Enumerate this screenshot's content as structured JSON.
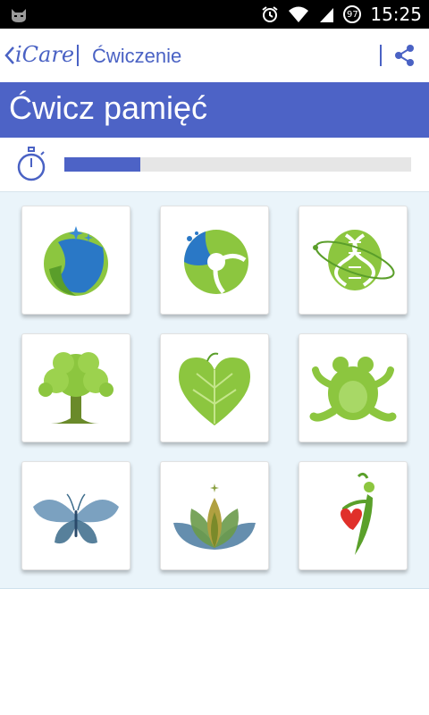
{
  "status_bar": {
    "time": "15:25",
    "battery": "97"
  },
  "app_bar": {
    "app_name": "iCare",
    "screen_title": "Ćwiczenie"
  },
  "banner": {
    "title": "Ćwicz pamięć"
  },
  "timer": {
    "progress": 0.22
  },
  "tiles": [
    {
      "icon": "water-leaf-icon"
    },
    {
      "icon": "recycle-circle-icon"
    },
    {
      "icon": "dna-icon"
    },
    {
      "icon": "tree-icon"
    },
    {
      "icon": "heart-leaf-icon"
    },
    {
      "icon": "frog-icon"
    },
    {
      "icon": "butterfly-icon"
    },
    {
      "icon": "lotus-icon"
    },
    {
      "icon": "heart-figure-icon"
    }
  ],
  "colors": {
    "accent": "#4d63c6",
    "leaf_green": "#8cc63f",
    "water_blue": "#2a78c6",
    "grid_background": "#eaf4fa"
  }
}
